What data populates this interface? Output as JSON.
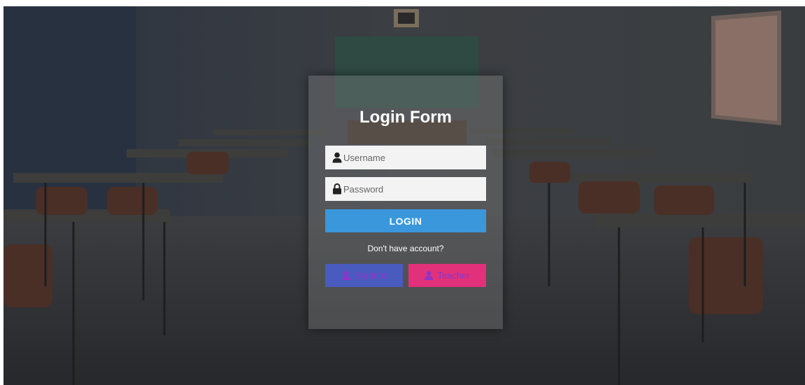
{
  "form": {
    "title": "Login Form",
    "username_placeholder": "Username",
    "password_placeholder": "Password",
    "login_label": "LOGIN",
    "signup_prompt": "Don't have account?",
    "student_label": "Student",
    "teacher_label": "Teacher"
  },
  "icons": {
    "username": "user-icon",
    "password": "lock-icon",
    "student": "user-icon",
    "teacher": "user-icon"
  },
  "colors": {
    "login_button": "#3a97db",
    "student_button": "#4a5bbf",
    "teacher_button": "#e0317a",
    "role_label": "#8e35c9"
  }
}
